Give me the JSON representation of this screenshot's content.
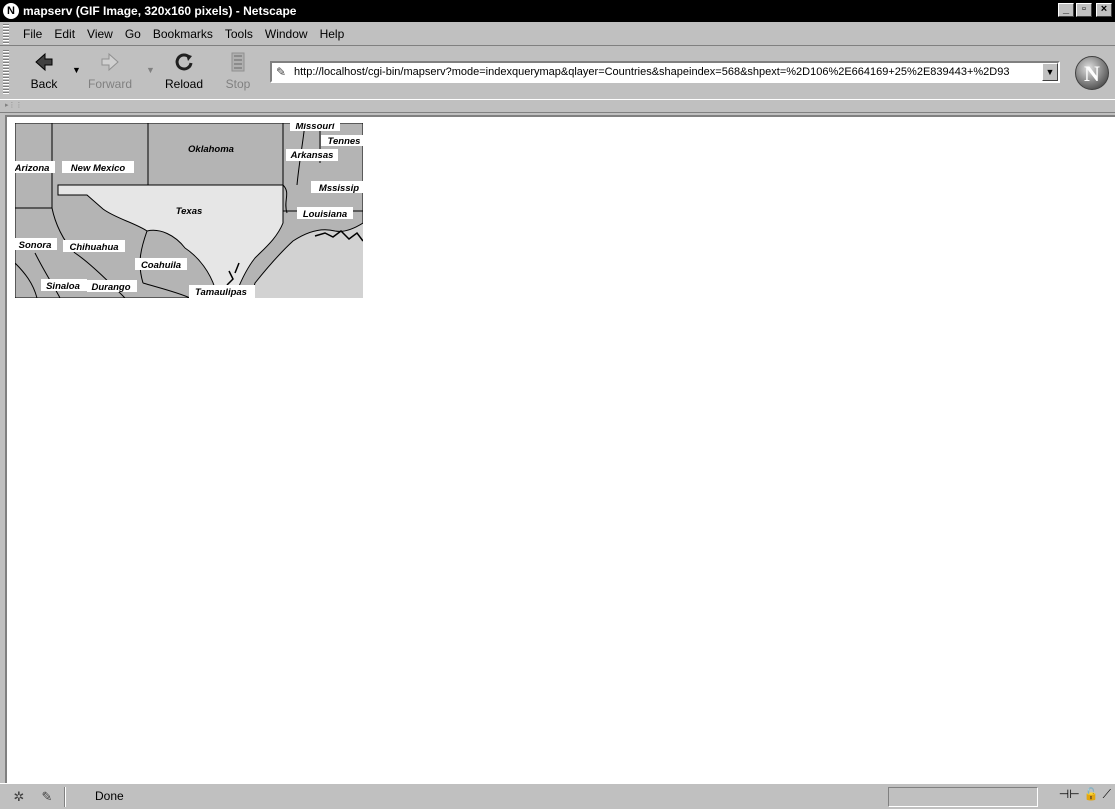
{
  "window": {
    "title": "mapserv (GIF Image, 320x160 pixels) - Netscape",
    "app_icon": "netscape-n-icon",
    "controls": [
      "minimize",
      "maximize",
      "close"
    ]
  },
  "menubar": {
    "items": [
      "File",
      "Edit",
      "View",
      "Go",
      "Bookmarks",
      "Tools",
      "Window",
      "Help"
    ]
  },
  "toolbar": {
    "back_label": "Back",
    "forward_label": "Forward",
    "reload_label": "Reload",
    "stop_label": "Stop",
    "url": "http://localhost/cgi-bin/mapserv?mode=indexquerymap&qlayer=Countries&shapeindex=568&shpext=%2D106%2E664169+25%2E839443+%2D93"
  },
  "map": {
    "labels": {
      "arizona": "Arizona",
      "new_mexico": "New Mexico",
      "oklahoma": "Oklahoma",
      "missouri": "Missouri",
      "tennessee": "Tennes",
      "arkansas": "Arkansas",
      "mississippi": "Mssissip",
      "texas": "Texas",
      "louisiana": "Louisiana",
      "sonora": "Sonora",
      "chihuahua": "Chihuahua",
      "coahuila": "Coahuila",
      "sinaloa": "Sinaloa",
      "durango": "Durango",
      "tamaulipas": "Tamaulipas"
    },
    "colors": {
      "highlight": "#e6e6e6",
      "land": "#b4b4b4",
      "sea": "#d2d2d2"
    }
  },
  "statusbar": {
    "status": "Done"
  }
}
